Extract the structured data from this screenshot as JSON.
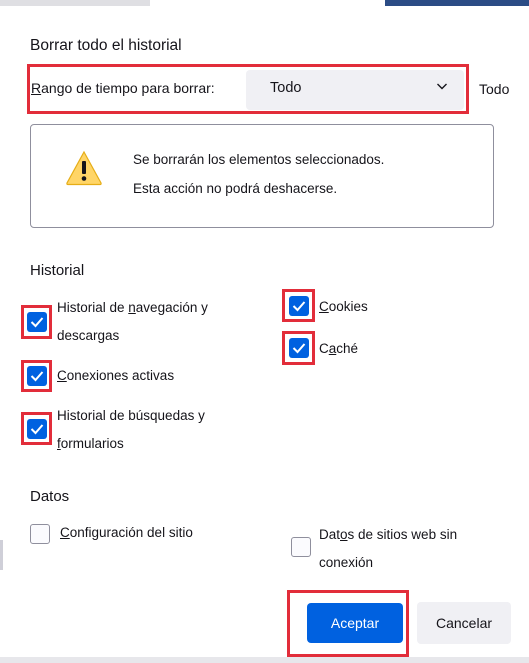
{
  "dialog": {
    "title": "Borrar todo el historial",
    "range": {
      "label_prefix": "R",
      "label_rest": "ango de tiempo para borrar:",
      "selected": "Todo",
      "extra_text": "Todo"
    },
    "warning": {
      "line1": "Se borrarán los elementos seleccionados.",
      "line2": "Esta acción no podrá deshacerse."
    },
    "history_section": {
      "heading": "Historial",
      "items": {
        "browsing": {
          "pre": "Historial de ",
          "key": "n",
          "post": "avegación y",
          "line2": "descargas",
          "checked": true
        },
        "connections": {
          "pre": "",
          "key": "C",
          "post": "onexiones activas",
          "checked": true
        },
        "searches": {
          "line1": "Historial de búsquedas y",
          "key": "f",
          "post": "ormularios",
          "checked": true
        },
        "cookies": {
          "pre": "",
          "key": "C",
          "post": "ookies",
          "checked": true
        },
        "cache": {
          "pre": "C",
          "key": "a",
          "post": "ché",
          "checked": true
        }
      }
    },
    "data_section": {
      "heading": "Datos",
      "items": {
        "site_settings": {
          "pre": "",
          "key": "C",
          "post": "onfiguración del sitio",
          "checked": false
        },
        "offline_data": {
          "pre": "Dat",
          "key": "o",
          "post": "s de sitios web sin",
          "line2": "conexión",
          "checked": false
        }
      }
    },
    "buttons": {
      "accept": "Aceptar",
      "cancel": "Cancelar"
    }
  },
  "colors": {
    "accent": "#0061e0",
    "highlight": "#e22d3a",
    "warning": "#ffd567"
  },
  "icons": {
    "warning": "warning-triangle-icon",
    "dropdown": "chevron-down-icon",
    "check": "checkmark-icon"
  }
}
